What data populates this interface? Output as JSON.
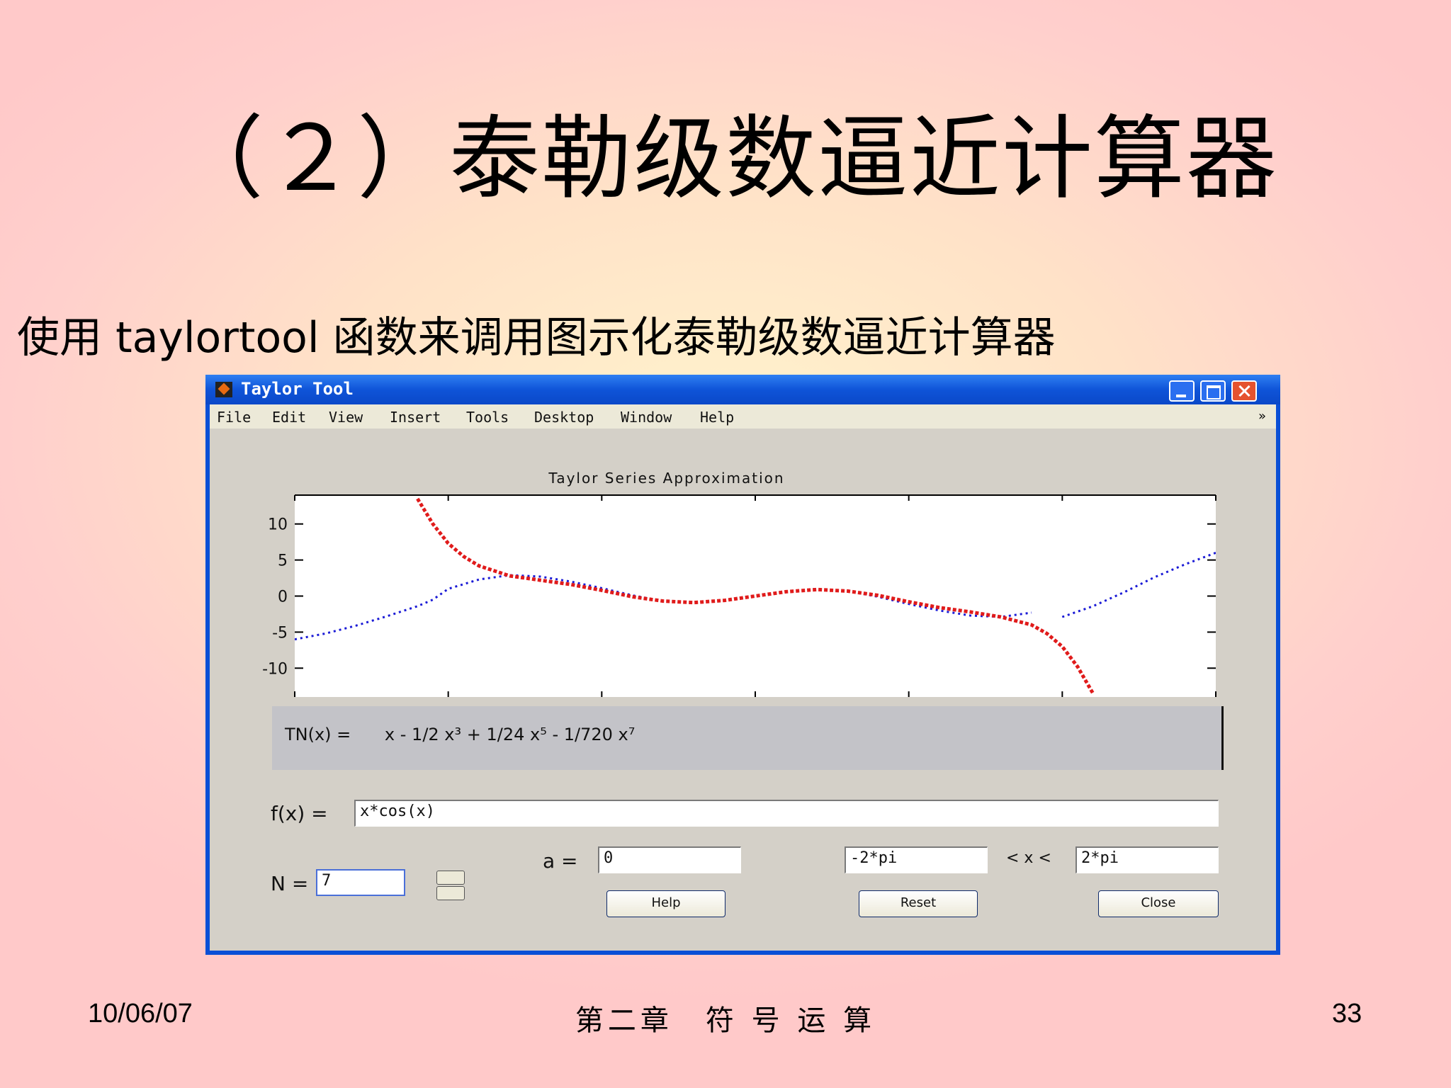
{
  "slide": {
    "title": "（２）泰勒级数逼近计算器",
    "subtitle": "使用 taylortool 函数来调用图示化泰勒级数逼近计算器",
    "footer_date": "10/06/07",
    "footer_center": "第二章　符 号 运 算",
    "footer_page": "33"
  },
  "window": {
    "title": "Taylor Tool",
    "menu": [
      "File",
      "Edit",
      "View",
      "Insert",
      "Tools",
      "Desktop",
      "Window",
      "Help"
    ],
    "menu_arrow": "»"
  },
  "chart_data": {
    "type": "line",
    "title": "Taylor Series Approximation",
    "xlim": [
      -6,
      6
    ],
    "ylim": [
      -14,
      14
    ],
    "xticks": [
      -6,
      -4,
      -2,
      0,
      2,
      4,
      6
    ],
    "yticks": [
      10,
      5,
      0,
      -5,
      -10
    ],
    "series": [
      {
        "color": "#1b1bd6",
        "style": "dotted",
        "x": [
          -6,
          -5.6,
          -5.2,
          -4.8,
          -4.4,
          -4.2,
          -4.0,
          -3.6,
          -3.2,
          -2.8,
          -2.4,
          -2.0,
          -1.6,
          -1.2,
          -0.8,
          -0.4,
          0,
          0.4,
          0.8,
          1.2,
          1.6,
          2.0,
          2.4,
          2.8,
          3.2,
          3.6
        ],
        "y": [
          -6.0,
          -5.2,
          -4.1,
          -2.8,
          -1.4,
          -0.5,
          1.0,
          2.3,
          2.9,
          2.7,
          2.0,
          1.1,
          0.1,
          -0.7,
          -1.0,
          -0.6,
          0,
          0.6,
          1.0,
          0.7,
          -0.1,
          -1.1,
          -2.0,
          -2.7,
          -2.9,
          -2.3
        ]
      },
      {
        "color": "#1b1bd6",
        "style": "dotted",
        "x": [
          4.0,
          4.4,
          4.8,
          5.2,
          5.6,
          6.0
        ],
        "y": [
          -2.9,
          -1.4,
          0.5,
          2.6,
          4.4,
          6.0
        ]
      },
      {
        "color": "#e01b1b",
        "style": "dotted",
        "x": [
          -4.4,
          -4.2,
          -4.0,
          -3.8,
          -3.6,
          -3.4,
          -3.2,
          -2.8,
          -2.4,
          -2.0,
          -1.6,
          -1.2,
          -0.8,
          -0.4,
          0,
          0.4,
          0.8,
          1.2,
          1.6,
          2.0,
          2.4,
          2.8,
          3.2,
          3.6,
          3.8,
          4.0,
          4.2,
          4.4
        ],
        "y": [
          13.5,
          10.0,
          7.3,
          5.5,
          4.2,
          3.5,
          2.8,
          2.2,
          1.6,
          0.8,
          -0.1,
          -0.7,
          -0.9,
          -0.6,
          0,
          0.6,
          0.9,
          0.7,
          0.1,
          -0.8,
          -1.6,
          -2.2,
          -2.9,
          -4.0,
          -5.2,
          -7.0,
          -9.8,
          -13.5
        ]
      }
    ]
  },
  "controls": {
    "formula_label": "TN(x) =",
    "formula_text": "x - 1/2 x³ + 1/24 x⁵ - 1/720 x⁷",
    "fx_label": "f(x) =",
    "fx_value": "x*cos(x)",
    "n_label": "N =",
    "n_value": "7",
    "a_label": "a =",
    "a_value": "0",
    "xmin_value": "-2*pi",
    "range_label": "< x <",
    "xmax_value": "2*pi",
    "help_label": "Help",
    "reset_label": "Reset",
    "close_label": "Close"
  }
}
